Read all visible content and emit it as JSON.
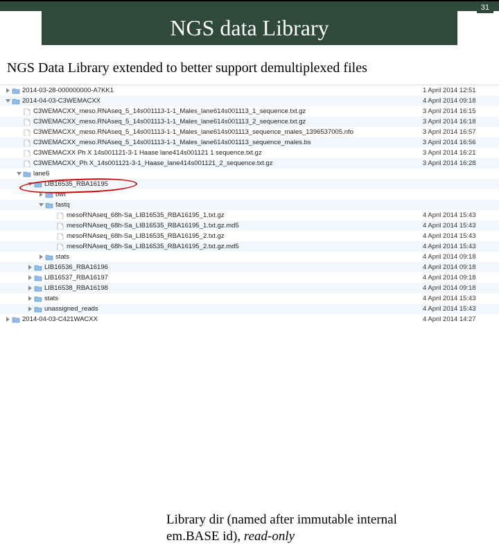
{
  "page": {
    "number": "31"
  },
  "header": {
    "rule": true,
    "title": "NGS data Library"
  },
  "subtitle": "NGS Data Library extended to better support demultiplexed files",
  "annotation": {
    "line1": "Library dir (named after immutable internal",
    "line2": "em.BASE id), ",
    "readonly": "read-only"
  },
  "icons": {
    "folder": "folder-icon",
    "file": "file-icon",
    "triangle_right": "disclosure-right-icon",
    "triangle_down": "disclosure-down-icon"
  },
  "rows": [
    {
      "indent": 0,
      "disclosure": "right",
      "icon": "folder",
      "name": "2014-03-28-000000000-A7KK1",
      "date": "1 April 2014 12:51",
      "alt": false
    },
    {
      "indent": 0,
      "disclosure": "down",
      "icon": "folder",
      "name": "2014-04-03-C3WEMACXX",
      "date": "4 April 2014 09:18",
      "alt": true
    },
    {
      "indent": 1,
      "disclosure": "",
      "icon": "file",
      "name": "C3WEMACXX_meso.RNAseq_5_14s001113-1-1_Males_lane614s001113_1_sequence.txt.gz",
      "date": "3 April 2014 16:15",
      "alt": false
    },
    {
      "indent": 1,
      "disclosure": "",
      "icon": "file",
      "name": "C3WEMACXX_meso.RNAseq_5_14s001113-1-1_Males_lane614s001113_2_sequence.txt.gz",
      "date": "3 April 2014 16:18",
      "alt": true
    },
    {
      "indent": 1,
      "disclosure": "",
      "icon": "file",
      "name": "C3WEMACXX_meso.RNAseq_5_14s001113-1-1_Males_lane614s001113_sequence_males_1396537005.nfo",
      "date": "3 April 2014 16:57",
      "alt": false
    },
    {
      "indent": 1,
      "disclosure": "",
      "icon": "file",
      "name": "C3WEMACXX_meso.RNAseq_5_14s001113-1-1_Males_lane614s001113_sequence_males.bs",
      "date": "3 April 2014 16:56",
      "alt": true
    },
    {
      "indent": 1,
      "disclosure": "",
      "icon": "file",
      "name": "C3WEMACXX Ph X 14s001121-3-1 Haase lane414s001121 1 sequence.txt.gz",
      "date": "3 April 2014 16:21",
      "alt": false
    },
    {
      "indent": 1,
      "disclosure": "",
      "icon": "file",
      "name": "C3WEMACXX_Ph X_14s001121-3-1_Haase_lane414s001121_2_sequence.txt.gz",
      "date": "3 April 2014 16:28",
      "alt": true
    },
    {
      "indent": 1,
      "disclosure": "down",
      "icon": "folder",
      "name": "lane6",
      "date": "",
      "alt": false
    },
    {
      "indent": 2,
      "disclosure": "down",
      "icon": "folder",
      "name": "LIB16535_RBA16195",
      "date": "",
      "alt": true
    },
    {
      "indent": 3,
      "disclosure": "right",
      "icon": "folder",
      "name": "bwt",
      "date": "",
      "alt": false
    },
    {
      "indent": 3,
      "disclosure": "down",
      "icon": "folder",
      "name": "fastq",
      "date": "",
      "alt": true
    },
    {
      "indent": 4,
      "disclosure": "",
      "icon": "file",
      "name": "mesoRNAseq_68h-Sa_LIB16535_RBA16195_1.txt.gz",
      "date": "4 April 2014 15:43",
      "alt": false
    },
    {
      "indent": 4,
      "disclosure": "",
      "icon": "file",
      "name": "mesoRNAseq_68h-Sa_LIB16535_RBA16195_1.txt.gz.md5",
      "date": "4 April 2014 15:43",
      "alt": true
    },
    {
      "indent": 4,
      "disclosure": "",
      "icon": "file",
      "name": "mesoRNAseq_68h-Sa_LIB16535_RBA16195_2.txt.gz",
      "date": "4 April 2014 15:43",
      "alt": false
    },
    {
      "indent": 4,
      "disclosure": "",
      "icon": "file",
      "name": "mesoRNAseq_68h-Sa_LIB16535_RBA16195_2.txt.gz.md5",
      "date": "4 April 2014 15:43",
      "alt": true
    },
    {
      "indent": 3,
      "disclosure": "right",
      "icon": "folder",
      "name": "stats",
      "date": "4 April 2014 09:18",
      "alt": false
    },
    {
      "indent": 2,
      "disclosure": "right",
      "icon": "folder",
      "name": "LIB16536_RBA16196",
      "date": "4 April 2014 09:18",
      "alt": true
    },
    {
      "indent": 2,
      "disclosure": "right",
      "icon": "folder",
      "name": "LIB16537_RBA16197",
      "date": "4 April 2014 09:18",
      "alt": false
    },
    {
      "indent": 2,
      "disclosure": "right",
      "icon": "folder",
      "name": "LIB16538_RBA16198",
      "date": "4 April 2014 09:18",
      "alt": true
    },
    {
      "indent": 2,
      "disclosure": "right",
      "icon": "folder",
      "name": "stats",
      "date": "4 April 2014 15:43",
      "alt": false
    },
    {
      "indent": 2,
      "disclosure": "right",
      "icon": "folder",
      "name": "unassigned_reads",
      "date": "4 April 2014 15:43",
      "alt": true
    },
    {
      "indent": 0,
      "disclosure": "right",
      "icon": "folder",
      "name": "2014-04-03-C421WACXX",
      "date": "4 April 2014 14:27",
      "alt": false
    }
  ]
}
